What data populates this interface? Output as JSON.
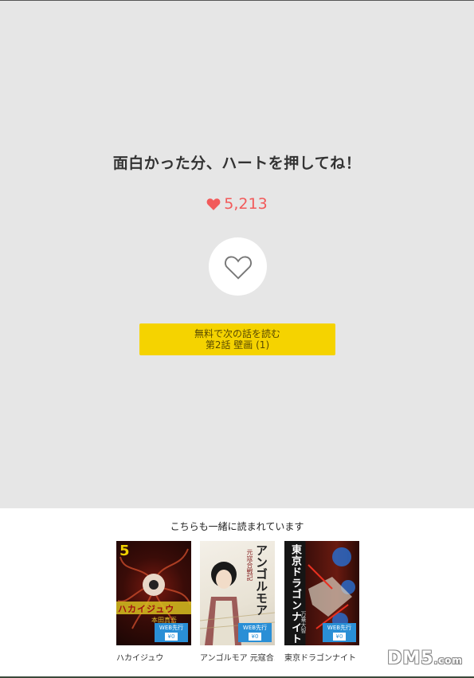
{
  "headline": "面白かった分、ハートを押してね！",
  "likes": {
    "count": "5,213"
  },
  "next_button": {
    "line1": "無料で次の話を読む",
    "line2": "第2話 壁画 (1)"
  },
  "recommend": {
    "title": "こちらも一緒に読まれています",
    "books": [
      {
        "title": "ハカイジュウ",
        "volume": "5",
        "cover_text": "ハカイジュウ",
        "author": "本田真吾",
        "badge": "WEB先行",
        "badge_price": "¥0"
      },
      {
        "title": "アンゴルモア 元寇合…",
        "cover_text": "アンゴルモア",
        "cover_sub": "元寇合戦記",
        "badge": "WEB先行",
        "badge_price": "¥0"
      },
      {
        "title": "東京ドラゴンナイト",
        "cover_text": "東京ドラゴンナイト",
        "author": "万乗大智",
        "badge": "WEB先行",
        "badge_price": "¥0"
      }
    ]
  },
  "watermark": {
    "main": "DM5",
    "suffix": ".com"
  },
  "colors": {
    "accent_yellow": "#f5d300",
    "heart_red": "#f25a5a",
    "badge_blue": "#2a8fd6"
  }
}
